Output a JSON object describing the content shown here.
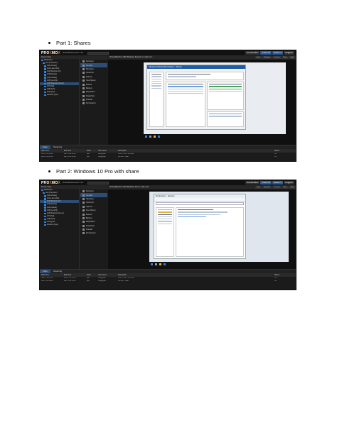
{
  "bullets": [
    {
      "label": "Part 1: Shares"
    },
    {
      "label": "Part 2: Windows 10 Pro with share"
    }
  ],
  "screenshots": [
    {
      "logo_prefix": "PRO",
      "logo_x": "X",
      "logo_suffix": "MO",
      "logo_tail": "X",
      "top_subtitle": "Virtual Environment 7.4-3",
      "buttons": [
        "Documentation",
        "Create VM",
        "Create CT",
        "root@pam"
      ],
      "tree_header": "Server View",
      "tree_items": [
        "Datacenter",
        "pve (Computer)",
        "100 (Ubuntu)",
        "101 (Linux Mint)",
        "102 (Windows 10)",
        "103 (Debian)",
        "104 (Fedora)",
        "105 (CentOS)",
        "106 (Windows Server)",
        "107 (Kali)",
        "108 (Arch)",
        "local (pve)",
        "local-lvm (pve)"
      ],
      "menu_items": [
        "Summary",
        "Console",
        "Hardware",
        "Cloud-Init",
        "Options",
        "Task History",
        "Monitor",
        "Backup",
        "Replication",
        "Snapshots",
        "Firewall",
        "Permissions"
      ],
      "crumb": "Virtual Machine 106 (Windows Server) on node 'pve'",
      "crumb_buttons": [
        "Start",
        "Shutdown",
        "Console",
        "More",
        "Help"
      ],
      "window_title": "Advanced Sharing Permissions - Shares",
      "task_tabs": [
        "Tasks",
        "Cluster log"
      ],
      "task_headers": [
        "Start Time",
        "End Time",
        "Node",
        "User name",
        "Description",
        "Status"
      ],
      "task_rows": [
        [
          "Jan 07 09:38:12",
          "Jan 07 09:38:13",
          "pve",
          "root@pam",
          "VM/CT 106 - Console",
          "OK"
        ],
        [
          "Jan 07 09:35:44",
          "Jan 07 09:35:46",
          "pve",
          "root@pam",
          "VM 106 - Start",
          "OK"
        ]
      ]
    },
    {
      "logo_prefix": "PRO",
      "logo_x": "X",
      "logo_suffix": "MO",
      "logo_tail": "X",
      "top_subtitle": "Virtual Environment 7.4-3",
      "buttons": [
        "Documentation",
        "Create VM",
        "Create CT",
        "root@pam"
      ],
      "tree_header": "Server View",
      "tree_items": [
        "Datacenter",
        "pve (Computer)",
        "100 (Ubuntu)",
        "101 (Linux Mint)",
        "102 (Windows 10)",
        "103 (Debian)",
        "104 (Fedora)",
        "105 (CentOS)",
        "106 (Windows Server)",
        "107 (Kali)",
        "108 (Arch)",
        "local (pve)",
        "local-lvm (pve)"
      ],
      "menu_items": [
        "Summary",
        "Console",
        "Hardware",
        "Cloud-Init",
        "Options",
        "Task History",
        "Monitor",
        "Backup",
        "Replication",
        "Snapshots",
        "Firewall",
        "Permissions"
      ],
      "crumb": "Virtual Machine 102 (Windows 10) on node 'pve'",
      "crumb_buttons": [
        "Start",
        "Shutdown",
        "Console",
        "More",
        "Help"
      ],
      "window_title": "File Explorer - Network",
      "task_tabs": [
        "Tasks",
        "Cluster log"
      ],
      "task_headers": [
        "Start Time",
        "End Time",
        "Node",
        "User name",
        "Description",
        "Status"
      ],
      "task_rows": [
        [
          "Jan 07 10:02:31",
          "Jan 07 10:02:32",
          "pve",
          "root@pam",
          "VM/CT 102 - Console",
          "OK"
        ],
        [
          "Jan 07 09:59:10",
          "Jan 07 09:59:12",
          "pve",
          "root@pam",
          "VM 102 - Start",
          "OK"
        ]
      ]
    }
  ]
}
